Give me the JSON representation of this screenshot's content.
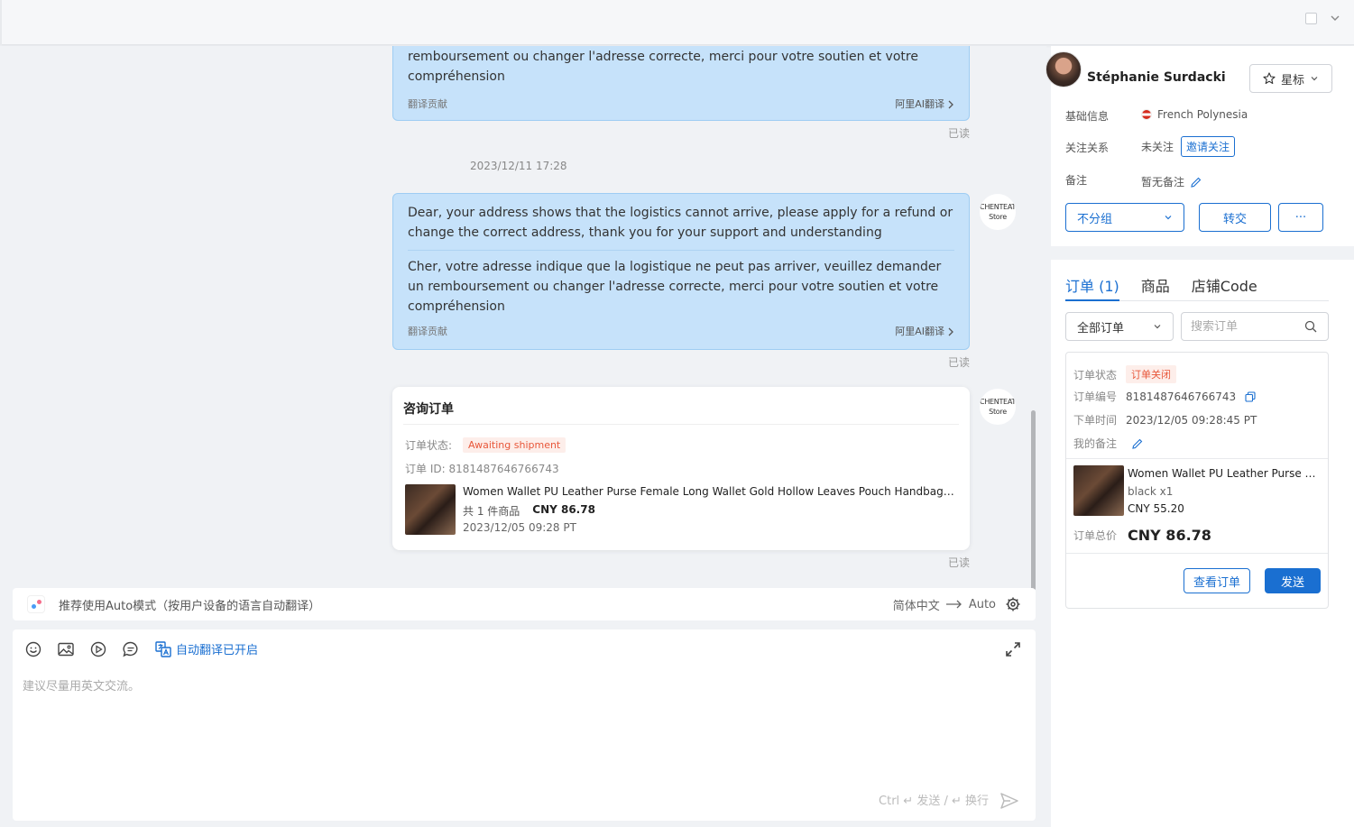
{
  "chat": {
    "msg1": {
      "translated": "remboursement ou changer l'adresse correcte, merci pour votre soutien et votre compréhension",
      "footer_left": "翻译贡献",
      "footer_right": "阿里AI翻译"
    },
    "read1": "已读",
    "timestamp": "2023/12/11 17:28",
    "msg2": {
      "original": "Dear, your address shows that the logistics cannot arrive, please apply for a refund or change the correct address, thank you for your support and understanding",
      "translated": "Cher, votre adresse indique que la logistique ne peut pas arriver, veuillez demander un remboursement ou changer l'adresse correcte, merci pour votre soutien et votre compréhension",
      "footer_left": "翻译贡献",
      "footer_right": "阿里AI翻译"
    },
    "read2": "已读",
    "store_avatar": {
      "line1": "CHENTEAT",
      "line2": "Store"
    },
    "order_card": {
      "title": "咨询订单",
      "status_label": "订单状态:",
      "status": "Awaiting shipment",
      "order_id": "订单 ID: 8181487646766743",
      "product_name": "Women Wallet PU Leather Purse Female Long Wallet Gold Hollow Leaves Pouch Handbag For W...",
      "count": "共 1 件商品",
      "price": "CNY 86.78",
      "date": "2023/12/05 09:28 PT"
    },
    "read3": "已读"
  },
  "tipbar": {
    "text": "推荐使用Auto模式（按用户设备的语言自动翻译）",
    "from_lang": "简体中文",
    "to_lang": "Auto"
  },
  "composer": {
    "auto_translate": "自动翻译已开启",
    "placeholder": "建议尽量用英文交流。",
    "hint": "Ctrl ↵ 发送 / ↵ 换行"
  },
  "customer": {
    "name": "Stéphanie Surdacki",
    "star_label": "星标",
    "basic_label": "基础信息",
    "country": "French Polynesia",
    "follow_label": "关注关系",
    "follow_status": "未关注",
    "invite_label": "邀请关注",
    "note_label": "备注",
    "note_value": "暂无备注",
    "group": "不分组",
    "transfer": "转交",
    "more": "···"
  },
  "orders": {
    "tabs": [
      "订单 (1)",
      "商品",
      "店铺Code"
    ],
    "filter": "全部订单",
    "search_placeholder": "搜索订单",
    "card": {
      "status_label": "订单状态",
      "status": "订单关闭",
      "number_label": "订单编号",
      "number": "8181487646766743",
      "time_label": "下单时间",
      "time": "2023/12/05 09:28:45 PT",
      "note_label": "我的备注",
      "product_name": "Women Wallet PU Leather Purse Fe...",
      "variant": "black x1",
      "price": "CNY 55.20",
      "total_label": "订单总价",
      "total": "CNY 86.78",
      "view_label": "查看订单",
      "send_label": "发送"
    }
  },
  "colors": {
    "accent": "#1a6fd1",
    "bubble": "#c6e2fa",
    "status_orange": "#e8573a"
  }
}
